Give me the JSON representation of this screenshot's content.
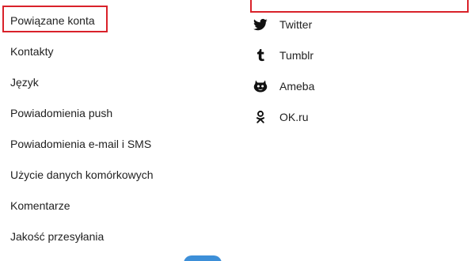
{
  "settings_menu": {
    "items": [
      {
        "label": "Powiązane konta"
      },
      {
        "label": "Kontakty"
      },
      {
        "label": "Język"
      },
      {
        "label": "Powiadomienia push"
      },
      {
        "label": "Powiadomienia e-mail i SMS"
      },
      {
        "label": "Użycie danych komórkowych"
      },
      {
        "label": "Komentarze"
      },
      {
        "label": "Jakość przesyłania"
      }
    ],
    "selected_index": 0
  },
  "linked_accounts": {
    "items": [
      {
        "label": "Twitter",
        "icon": "twitter-icon"
      },
      {
        "label": "Tumblr",
        "icon": "tumblr-icon"
      },
      {
        "label": "Ameba",
        "icon": "ameba-icon"
      },
      {
        "label": "OK.ru",
        "icon": "odnoklassniki-icon"
      }
    ]
  },
  "colors": {
    "highlight": "#d9222a",
    "accent": "#3d8fd8",
    "text": "#222222"
  }
}
